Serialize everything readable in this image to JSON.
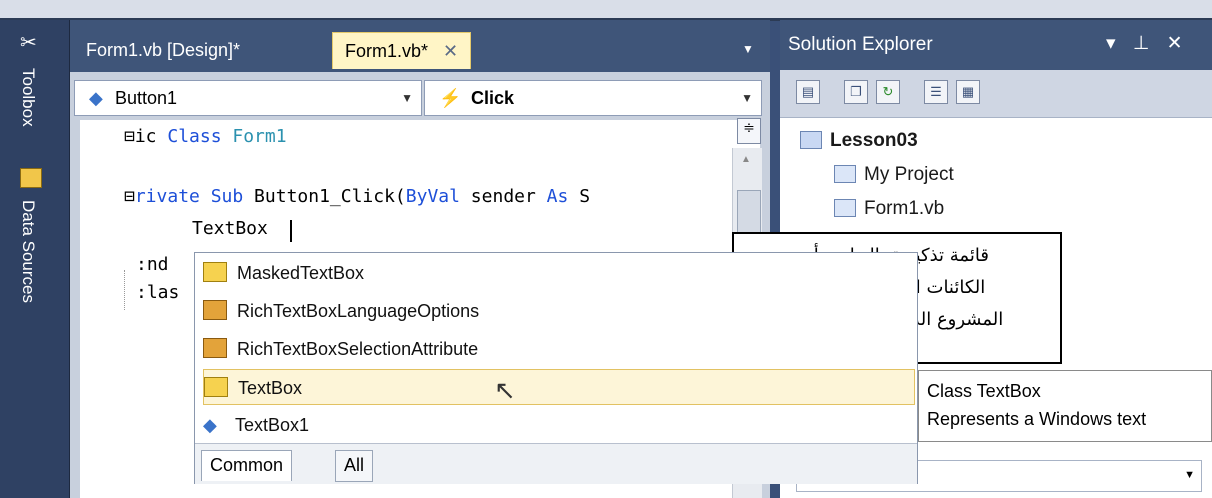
{
  "toolbox_tabs": {
    "toolbox": "Toolbox",
    "data_sources": "Data Sources"
  },
  "doc_tabs": [
    {
      "label": "Form1.vb [Design]*"
    },
    {
      "label": "Form1.vb*",
      "close": "✕"
    }
  ],
  "object_combo": {
    "value": "Button1"
  },
  "event_combo": {
    "value": "Click"
  },
  "code": {
    "line1": {
      "prefix": "ic ",
      "kw": "Class",
      "rest": " Form1"
    },
    "line2": {
      "kw1": "rivate Sub",
      "mid": " Button1_Click(",
      "kw2": "ByVal",
      "mid2": " sender ",
      "kw3": "As",
      "rest": " S"
    },
    "line3": "TextBox",
    "line4": ":nd ",
    "line5": ":las"
  },
  "solution_explorer": {
    "title": "Solution Explorer",
    "header_icons": "▾ ⊥ ✕",
    "project": "Lesson03",
    "items": [
      "My Project",
      "Form1.vb"
    ]
  },
  "callout": {
    "lines": [
      "قائمة تذكيرية بالعناصر أو",
      "الكائنات المستخدمة فى",
      "المشروع الذى يتم العمل فيه"
    ]
  },
  "intellisense": {
    "items": [
      "MaskedTextBox",
      "RichTextBoxLanguageOptions",
      "RichTextBoxSelectionAttribute",
      "TextBox",
      "TextBox1"
    ],
    "tabs": [
      "Common",
      "All"
    ]
  },
  "tooltip": {
    "line1": "Class TextBox",
    "line2": "Represents a Windows text"
  }
}
